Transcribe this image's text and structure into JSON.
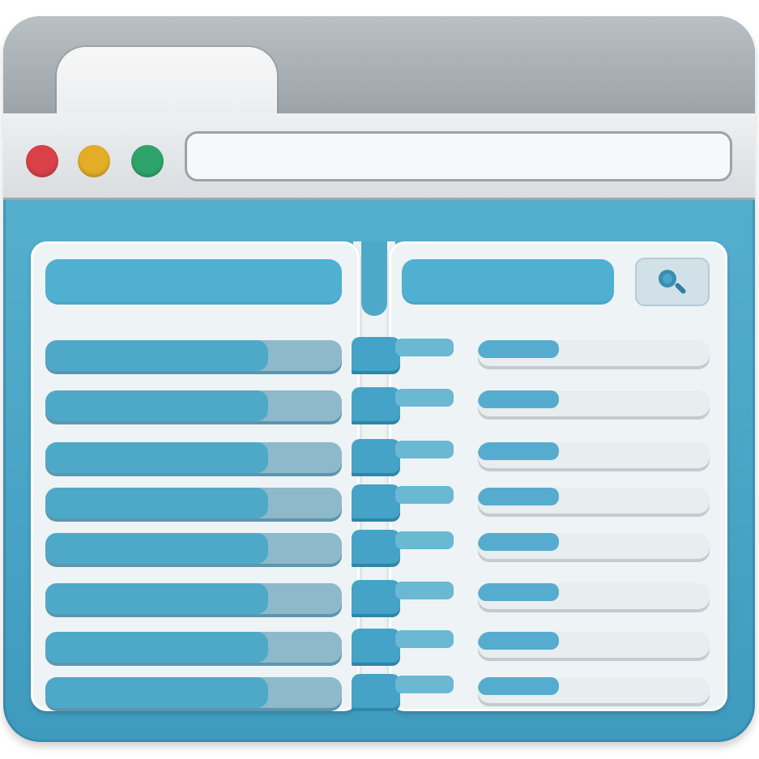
{
  "window": {
    "address_bar_value": "",
    "colors": {
      "frame": "#4ea9c9",
      "tab_strip": "#a9b0b5",
      "close": "#d94149",
      "minimize": "#e4ad28",
      "maximize": "#2fa46a"
    }
  },
  "header": {
    "left_label": "",
    "right_label": "",
    "search_icon": "search-icon"
  },
  "rows": [
    {
      "left_fill": 0.75,
      "right_fill": 0.35
    },
    {
      "left_fill": 0.75,
      "right_fill": 0.35
    },
    {
      "left_fill": 0.75,
      "right_fill": 0.35
    },
    {
      "left_fill": 0.75,
      "right_fill": 0.35
    },
    {
      "left_fill": 0.75,
      "right_fill": 0.35
    },
    {
      "left_fill": 0.75,
      "right_fill": 0.35
    },
    {
      "left_fill": 0.75,
      "right_fill": 0.35
    },
    {
      "left_fill": 0.75,
      "right_fill": 0.35
    }
  ]
}
